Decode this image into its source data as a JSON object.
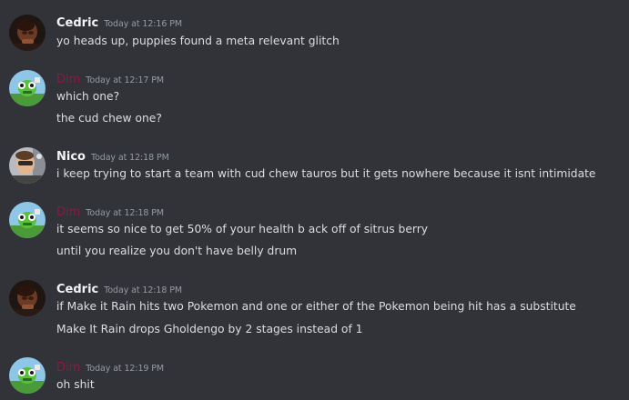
{
  "messages": [
    {
      "author": "Cedric",
      "timestamp": "Today at 12:16 PM",
      "avatar": "cedric-avatar",
      "lines": [
        "yo heads up, puppies found a meta relevant glitch"
      ]
    },
    {
      "author": "Dim",
      "timestamp": "Today at 12:17 PM",
      "avatar": "dim-avatar",
      "lines": [
        "which one?",
        "the cud chew one?"
      ]
    },
    {
      "author": "Nico",
      "timestamp": "Today at 12:18 PM",
      "avatar": "nico-avatar",
      "lines": [
        "i keep trying to start a team with cud chew tauros but it gets nowhere because it isnt intimidate"
      ]
    },
    {
      "author": "Dim",
      "timestamp": "Today at 12:18 PM",
      "avatar": "dim-avatar",
      "lines": [
        "it seems so nice to get 50% of your health b ack off of sitrus berry",
        "until you realize you don't have belly drum"
      ]
    },
    {
      "author": "Cedric",
      "timestamp": "Today at 12:18 PM",
      "avatar": "cedric-avatar",
      "lines": [
        "if Make it Rain hits two Pokemon and one or either of the Pokemon being hit has a substitute",
        "Make It Rain drops Gholdengo by 2 stages instead of 1"
      ]
    },
    {
      "author": "Dim",
      "timestamp": "Today at 12:19 PM",
      "avatar": "dim-avatar",
      "lines": [
        "oh shit"
      ]
    }
  ],
  "colors": {
    "background": "#313338",
    "author_default": "#f2f3f5",
    "author_dim": "#8b1a3f",
    "timestamp": "#949ba4",
    "message_text": "#dbdee1"
  }
}
